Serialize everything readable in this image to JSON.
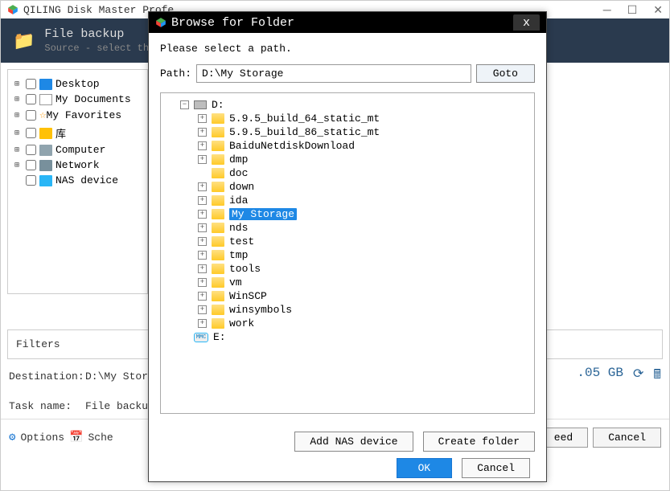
{
  "app_title": "QILING Disk Master Profe",
  "header": {
    "title": "File backup",
    "subtitle": "Source - select th"
  },
  "sidebar": {
    "items": [
      {
        "label": "Desktop",
        "has_children": true
      },
      {
        "label": "My Documents",
        "has_children": true
      },
      {
        "label": "My Favorites",
        "has_children": true
      },
      {
        "label": "库",
        "has_children": true
      },
      {
        "label": "Computer",
        "has_children": true
      },
      {
        "label": "Network",
        "has_children": true
      },
      {
        "label": "NAS device",
        "has_children": false
      }
    ]
  },
  "filters_label": "Filters",
  "destination": {
    "label": "Destination:",
    "value": "D:\\My Stora",
    "size": ".05 GB"
  },
  "task": {
    "label": "Task name:",
    "value": "File backup"
  },
  "bottom": {
    "options": "Options",
    "schedule": "Sche",
    "proceed": "eed",
    "cancel": "Cancel"
  },
  "dialog": {
    "title": "Browse for Folder",
    "prompt": "Please select a path.",
    "path_label": "Path:",
    "path_value": "D:\\My Storage",
    "goto": "Goto",
    "add_nas": "Add NAS device",
    "create_folder": "Create folder",
    "ok": "OK",
    "cancel": "Cancel",
    "tree": {
      "drive_d": "D:",
      "drive_e": "E:",
      "folders": [
        "5.9.5_build_64_static_mt",
        "5.9.5_build_86_static_mt",
        "BaiduNetdiskDownload",
        "dmp",
        "doc",
        "down",
        "ida",
        "My Storage",
        "nds",
        "test",
        "tmp",
        "tools",
        "vm",
        "WinSCP",
        "winsymbols",
        "work"
      ],
      "selected": "My Storage"
    }
  }
}
